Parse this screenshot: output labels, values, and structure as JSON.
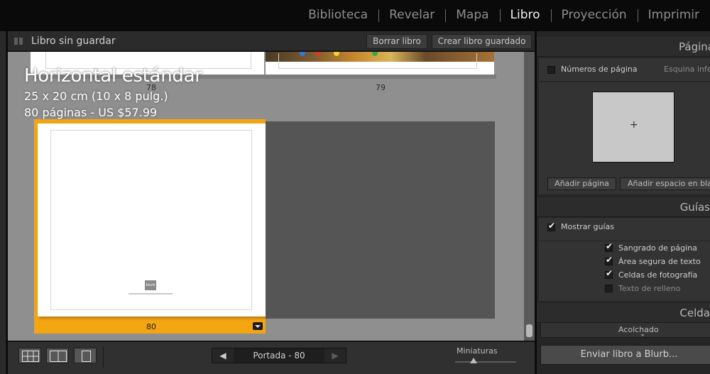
{
  "modules": [
    {
      "label": "Biblioteca",
      "active": false
    },
    {
      "label": "Revelar",
      "active": false
    },
    {
      "label": "Mapa",
      "active": false
    },
    {
      "label": "Libro",
      "active": true
    },
    {
      "label": "Proyección",
      "active": false
    },
    {
      "label": "Imprimir",
      "active": false
    }
  ],
  "header": {
    "title": "Libro sin guardar",
    "clear_label": "Borrar libro",
    "create_label": "Crear libro guardado"
  },
  "workspace": {
    "page_number_top": "78",
    "page_number_right": "79",
    "preset_name": "Horizontal estándar",
    "preset_size": "25 x 20 cm (10 x 8 pulg.)",
    "preset_pages_price": "80 páginas - US $57.99",
    "cover_number": "80",
    "blurb_logo": "blurb"
  },
  "toolbar": {
    "nav_label": "Portada - 80",
    "thumbnails_label": "Miniaturas",
    "thumbnails_level": 0.3
  },
  "panel": {
    "pagina": {
      "title": "Página",
      "page_numbers_label": "Números de página",
      "page_numbers_checked": false,
      "corner_value": "Esquina infe",
      "box_symbol": "+",
      "add_page_label": "Añadir página",
      "add_blank_label": "Añadir espacio en blan"
    },
    "guias": {
      "title": "Guías",
      "show_guides_label": "Mostrar guías",
      "show_guides_checked": true,
      "items": [
        {
          "label": "Sangrado de página",
          "checked": true
        },
        {
          "label": "Área segura de texto",
          "checked": true
        },
        {
          "label": "Celdas de fotografía",
          "checked": true
        },
        {
          "label": "Texto de relleno",
          "checked": false
        }
      ]
    },
    "celda": {
      "title": "Celda",
      "padding_label": "Acolchado"
    },
    "send_label": "Enviar libro a Blurb..."
  }
}
